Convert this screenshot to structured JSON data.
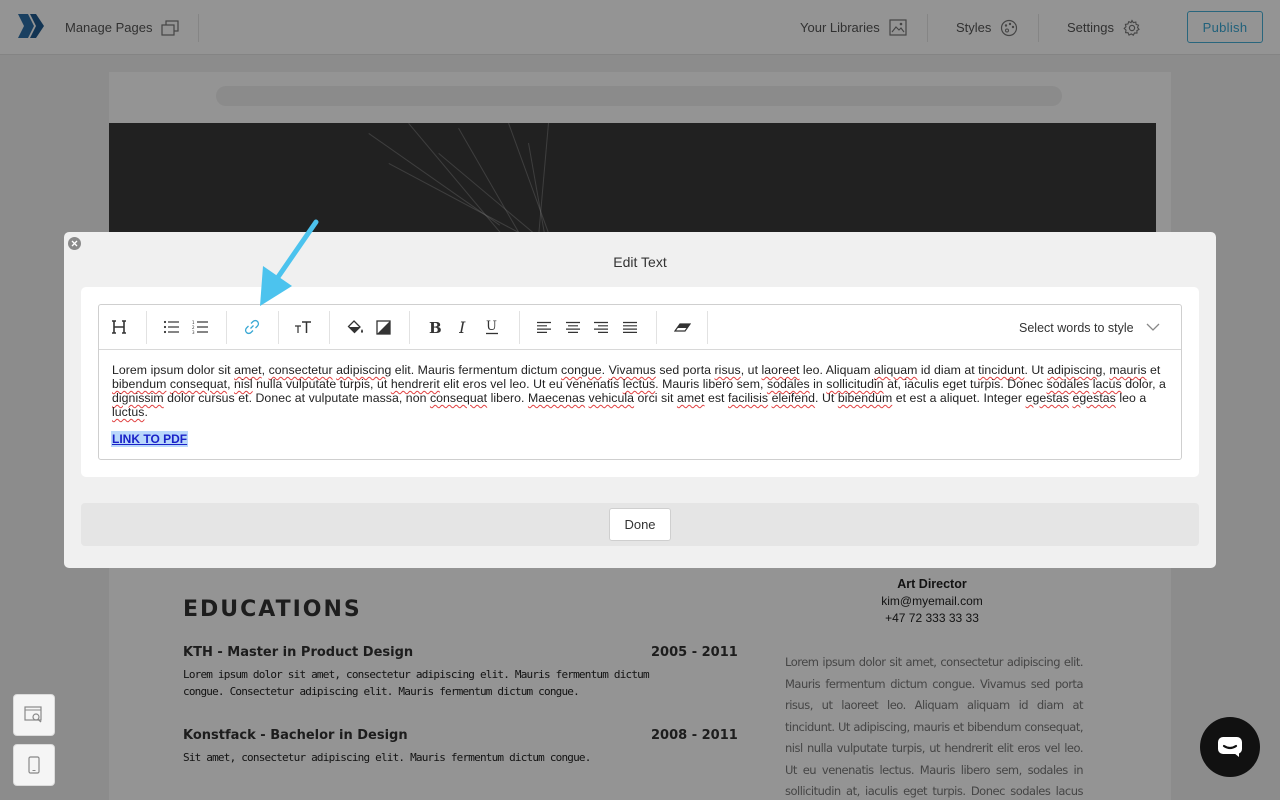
{
  "topbar": {
    "manage_pages": "Manage Pages",
    "libraries": "Your Libraries",
    "styles": "Styles",
    "settings": "Settings",
    "publish": "Publish"
  },
  "resume": {
    "section_heading": "EDUCATIONS",
    "education": [
      {
        "title": "KTH - Master in Product Design",
        "years": "2005 - 2011",
        "desc1": "Lorem ipsum dolor sit amet, consectetur adipiscing elit. Mauris fermentum dictum",
        "desc2": "congue. Consectetur adipiscing elit. Mauris fermentum dictum congue."
      },
      {
        "title": "Konstfack - Bachelor in Design",
        "years": "2008 - 2011",
        "desc1": "Sit amet, consectetur adipiscing elit. Mauris fermentum dictum congue.",
        "desc2": ""
      }
    ],
    "contact": {
      "role": "Art Director",
      "email": "kim@myemail.com",
      "phone": "+47 72 333 33 33"
    },
    "side_paragraph": "Lorem ipsum dolor sit amet, consectetur adipiscing elit. Mauris fermentum dictum congue. Vivamus sed porta risus, ut laoreet leo. Aliquam aliquam id diam at tincidunt. Ut adipiscing, mauris et bibendum consequat, nisl nulla vulputate turpis, ut hendrerit elit eros vel leo. Ut eu venenatis lectus. Mauris libero sem, sodales in sollicitudin at, iaculis eget turpis. Donec sodales lacus dolor, a dignissim dolor cursus et."
  },
  "modal": {
    "title": "Edit Text",
    "style_select": "Select words to style",
    "body_segments": [
      "Lorem ipsum dolor sit ",
      "amet",
      ", ",
      "consectetur",
      " ",
      "adipiscing",
      " elit. Mauris fermentum dictum ",
      "congue",
      ". ",
      "Vivamus",
      " sed porta ",
      "risus",
      ", ut ",
      "laoreet",
      " leo. Aliquam ",
      "aliquam",
      " id diam at ",
      "tincidunt",
      ". Ut ",
      "adipiscing",
      ", ",
      "mauris",
      " et ",
      "bibendum",
      " ",
      "consequat",
      ", ",
      "nisl",
      " nulla vulputate turpis, ut ",
      "hendrerit",
      " elit eros vel leo. Ut eu venenatis ",
      "lectus",
      ". Mauris libero sem, ",
      "sodales",
      " in ",
      "sollicitudin",
      " at, iaculis eget turpis. Donec ",
      "sodales",
      " ",
      "lacus",
      " dolor, a ",
      "dignissim",
      " dolor cursus et. Donec at vulputate massa, non ",
      "consequat",
      " libero. ",
      "Maecenas",
      " ",
      "vehicula",
      " orci sit ",
      "amet",
      " est ",
      "facilisis",
      " ",
      "eleifend",
      ". Ut ",
      "bibendum",
      " et est a aliquet. Integer ",
      "egestas",
      " ",
      "egestas",
      " leo a ",
      "luctus",
      "."
    ],
    "link_text": "LINK TO PDF",
    "done": "Done"
  },
  "colors": {
    "accent": "#3aa8d4",
    "arrow": "#4cc3ee",
    "link": "#1a22c8",
    "selection": "#b9d7fb"
  }
}
